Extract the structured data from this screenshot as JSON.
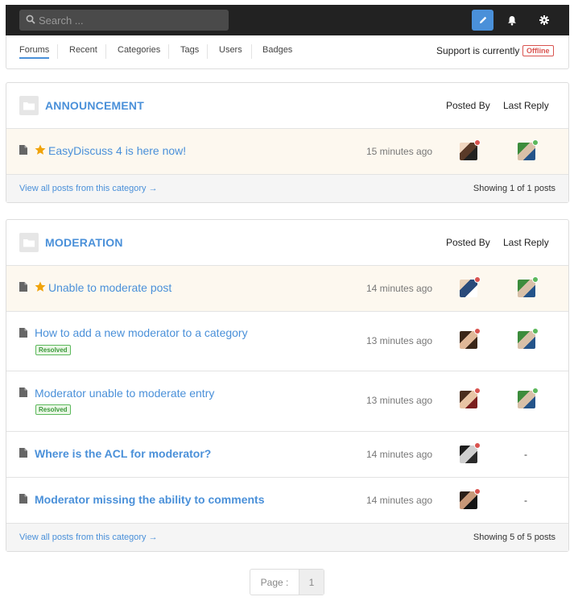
{
  "search": {
    "placeholder": "Search ..."
  },
  "toolbar": {
    "compose_icon": "pencil-icon",
    "bell_icon": "bell-icon",
    "settings_icon": "gear-icon"
  },
  "nav": {
    "items": [
      {
        "label": "Forums",
        "active": true
      },
      {
        "label": "Recent"
      },
      {
        "label": "Categories"
      },
      {
        "label": "Tags"
      },
      {
        "label": "Users"
      },
      {
        "label": "Badges"
      }
    ],
    "support_text": "Support is currently",
    "support_status": "Offline"
  },
  "columns": {
    "posted_by": "Posted By",
    "last_reply": "Last Reply"
  },
  "categories": [
    {
      "title": "ANNOUNCEMENT",
      "posts": [
        {
          "title": "EasyDiscuss 4 is here now!",
          "featured": true,
          "time": "15 minutes ago",
          "last_reply": "avatar"
        }
      ],
      "view_all": "View all posts from this category →",
      "showing": "Showing 1 of 1 posts"
    },
    {
      "title": "MODERATION",
      "posts": [
        {
          "title": "Unable to moderate post",
          "featured": true,
          "time": "14 minutes ago"
        },
        {
          "title": "How to add a new moderator to a category",
          "badge": "Resolved",
          "time": "13 minutes ago"
        },
        {
          "title": "Moderator unable to moderate entry",
          "badge": "Resolved",
          "time": "13 minutes ago"
        },
        {
          "title": "Where is the ACL for moderator?",
          "unread": true,
          "time": "14 minutes ago",
          "last_reply": "-"
        },
        {
          "title": "Moderator missing the ability to comments",
          "unread": true,
          "time": "14 minutes ago",
          "last_reply": "-"
        }
      ],
      "view_all": "View all posts from this category →",
      "showing": "Showing 5 of 5 posts"
    }
  ],
  "pagination": {
    "label": "Page :",
    "current": "1"
  },
  "colors": {
    "accent": "#4a90d9",
    "offline": "#d9534f",
    "online": "#5cb85c",
    "featured_bg": "#fdf8ef"
  }
}
